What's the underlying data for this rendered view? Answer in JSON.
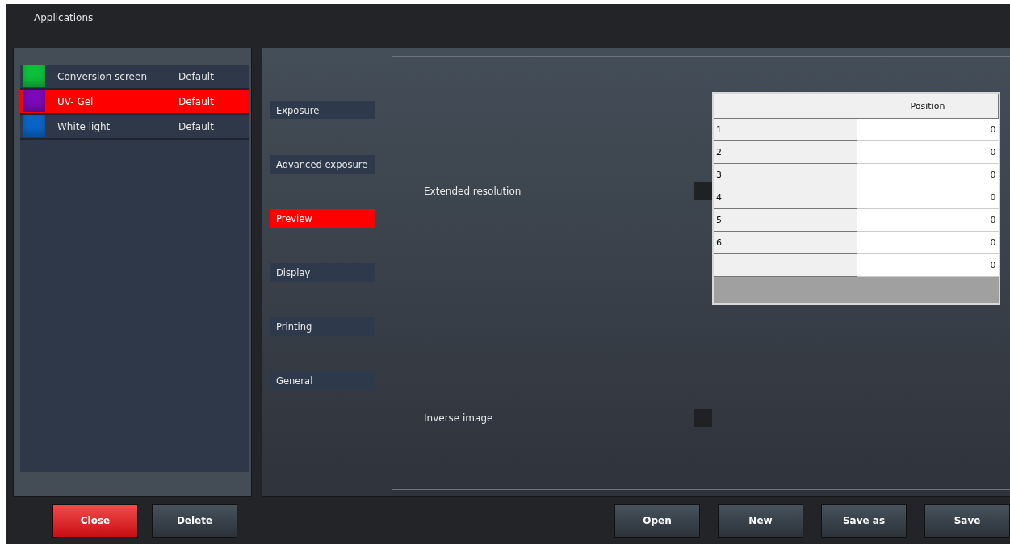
{
  "window": {
    "title": "Applications"
  },
  "applications": [
    {
      "name": "Conversion screen",
      "preset": "Default",
      "color": "#0cc03a",
      "selected": false
    },
    {
      "name": "UV- Gel",
      "preset": "Default",
      "color": "#7a0ab8",
      "selected": true
    },
    {
      "name": "White light",
      "preset": "Default",
      "color": "#0a64c8",
      "selected": false
    }
  ],
  "sections": [
    {
      "label": "Exposure",
      "selected": false
    },
    {
      "label": "Advanced exposure",
      "selected": false
    },
    {
      "label": "Preview",
      "selected": true
    },
    {
      "label": "Display",
      "selected": false
    },
    {
      "label": "Printing",
      "selected": false
    },
    {
      "label": "General",
      "selected": false
    }
  ],
  "options": [
    {
      "label": "Extended resolution",
      "checked": false
    },
    {
      "label": "Inverse image",
      "checked": false
    }
  ],
  "table": {
    "columns": [
      "Position"
    ],
    "rows": [
      {
        "header": "1",
        "value": "0"
      },
      {
        "header": "2",
        "value": "0"
      },
      {
        "header": "3",
        "value": "0"
      },
      {
        "header": "4",
        "value": "0"
      },
      {
        "header": "5",
        "value": "0"
      },
      {
        "header": "6",
        "value": "0"
      },
      {
        "header": "",
        "value": "0"
      }
    ]
  },
  "buttons_left": [
    {
      "label": "Close",
      "kind": "danger"
    },
    {
      "label": "Delete",
      "kind": "normal"
    }
  ],
  "buttons_right": [
    {
      "label": "Open",
      "kind": "normal"
    },
    {
      "label": "New",
      "kind": "normal"
    },
    {
      "label": "Save as",
      "kind": "normal"
    },
    {
      "label": "Save",
      "kind": "normal"
    }
  ]
}
